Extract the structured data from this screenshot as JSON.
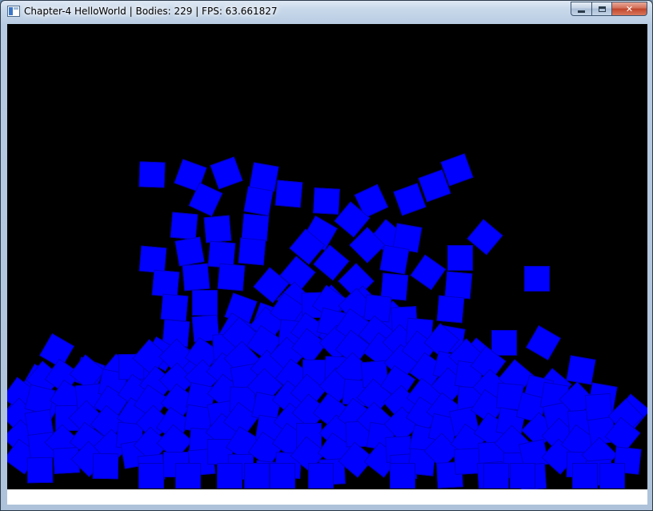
{
  "window": {
    "title": "Chapter-4 HelloWorld | Bodies: 229 | FPS: 63.661827",
    "controls": {
      "minimize": "minimize-icon",
      "maximize": "maximize-icon",
      "close": "✕"
    }
  },
  "scene": {
    "background_color": "#000000",
    "body_color": "#0000ff",
    "ground_color": "#ffffff",
    "body_count": 229
  }
}
